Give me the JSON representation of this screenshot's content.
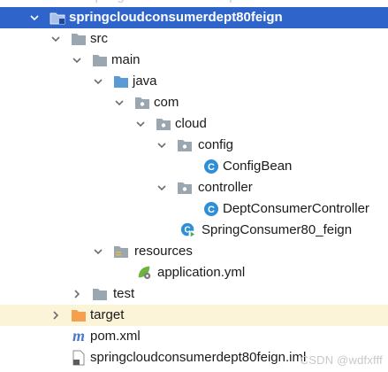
{
  "tree": {
    "partial_top_label": "springcloudconsumerdept80",
    "root": {
      "label": "springcloudconsumerdept80feign"
    },
    "src": "src",
    "main": "main",
    "java": "java",
    "com": "com",
    "cloud": "cloud",
    "config": "config",
    "config_bean": "ConfigBean",
    "controller": "controller",
    "dept_consumer_controller": "DeptConsumerController",
    "spring_consumer": "SpringConsumer80_feign",
    "resources": "resources",
    "application_yml": "application.yml",
    "test": "test",
    "target": "target",
    "pom_xml": "pom.xml",
    "iml_file": "springcloudconsumerdept80feign.iml"
  },
  "watermark": "CSDN @wdfxfff",
  "colors": {
    "selection": "#2f65ca",
    "highlight": "#fcf4d8",
    "folder": "#9aa7b0",
    "source_folder": "#5b9bd5",
    "class_icon": "#2f8fd6",
    "excluded_folder": "#f6a04d",
    "maven": "#4a7ac9",
    "spring": "#6db33f"
  }
}
